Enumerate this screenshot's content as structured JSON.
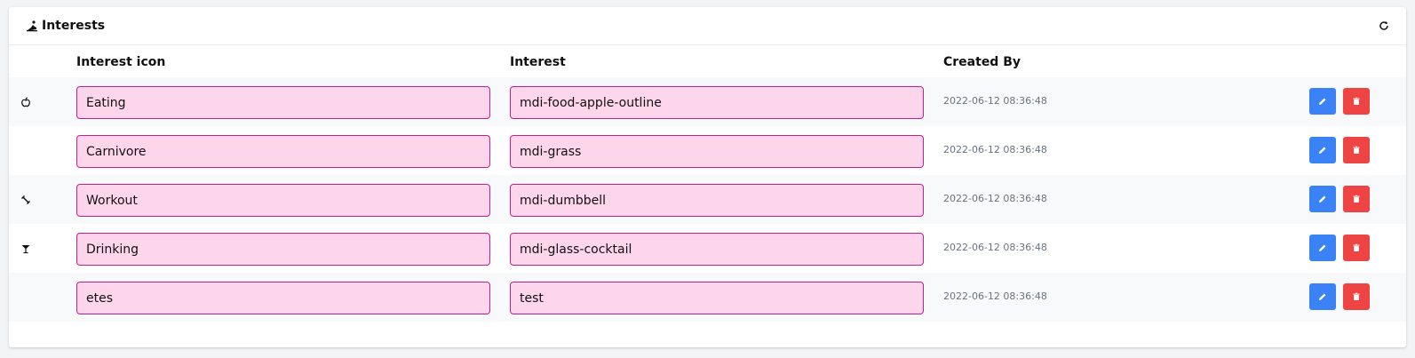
{
  "header": {
    "title": "Interests",
    "title_icon": "meditation-icon",
    "refresh_icon": "refresh-icon"
  },
  "columns": [
    "Interest icon",
    "Interest",
    "Created By"
  ],
  "rows": [
    {
      "icon": "food-apple-outline-icon",
      "name": "Eating",
      "icon_value": "mdi-food-apple-outline",
      "created": "2022-06-12 08:36:48"
    },
    {
      "icon": "",
      "name": "Carnivore",
      "icon_value": "mdi-grass",
      "created": "2022-06-12 08:36:48"
    },
    {
      "icon": "dumbbell-icon",
      "name": "Workout",
      "icon_value": "mdi-dumbbell",
      "created": "2022-06-12 08:36:48"
    },
    {
      "icon": "glass-cocktail-icon",
      "name": "Drinking",
      "icon_value": "mdi-glass-cocktail",
      "created": "2022-06-12 08:36:48"
    },
    {
      "icon": "",
      "name": "etes",
      "icon_value": "test",
      "created": "2022-06-12 08:36:48"
    }
  ],
  "colors": {
    "field_bg": "#fdd6ec",
    "field_border": "#c81e8a",
    "edit": "#3b82f6",
    "delete": "#ef4444"
  }
}
